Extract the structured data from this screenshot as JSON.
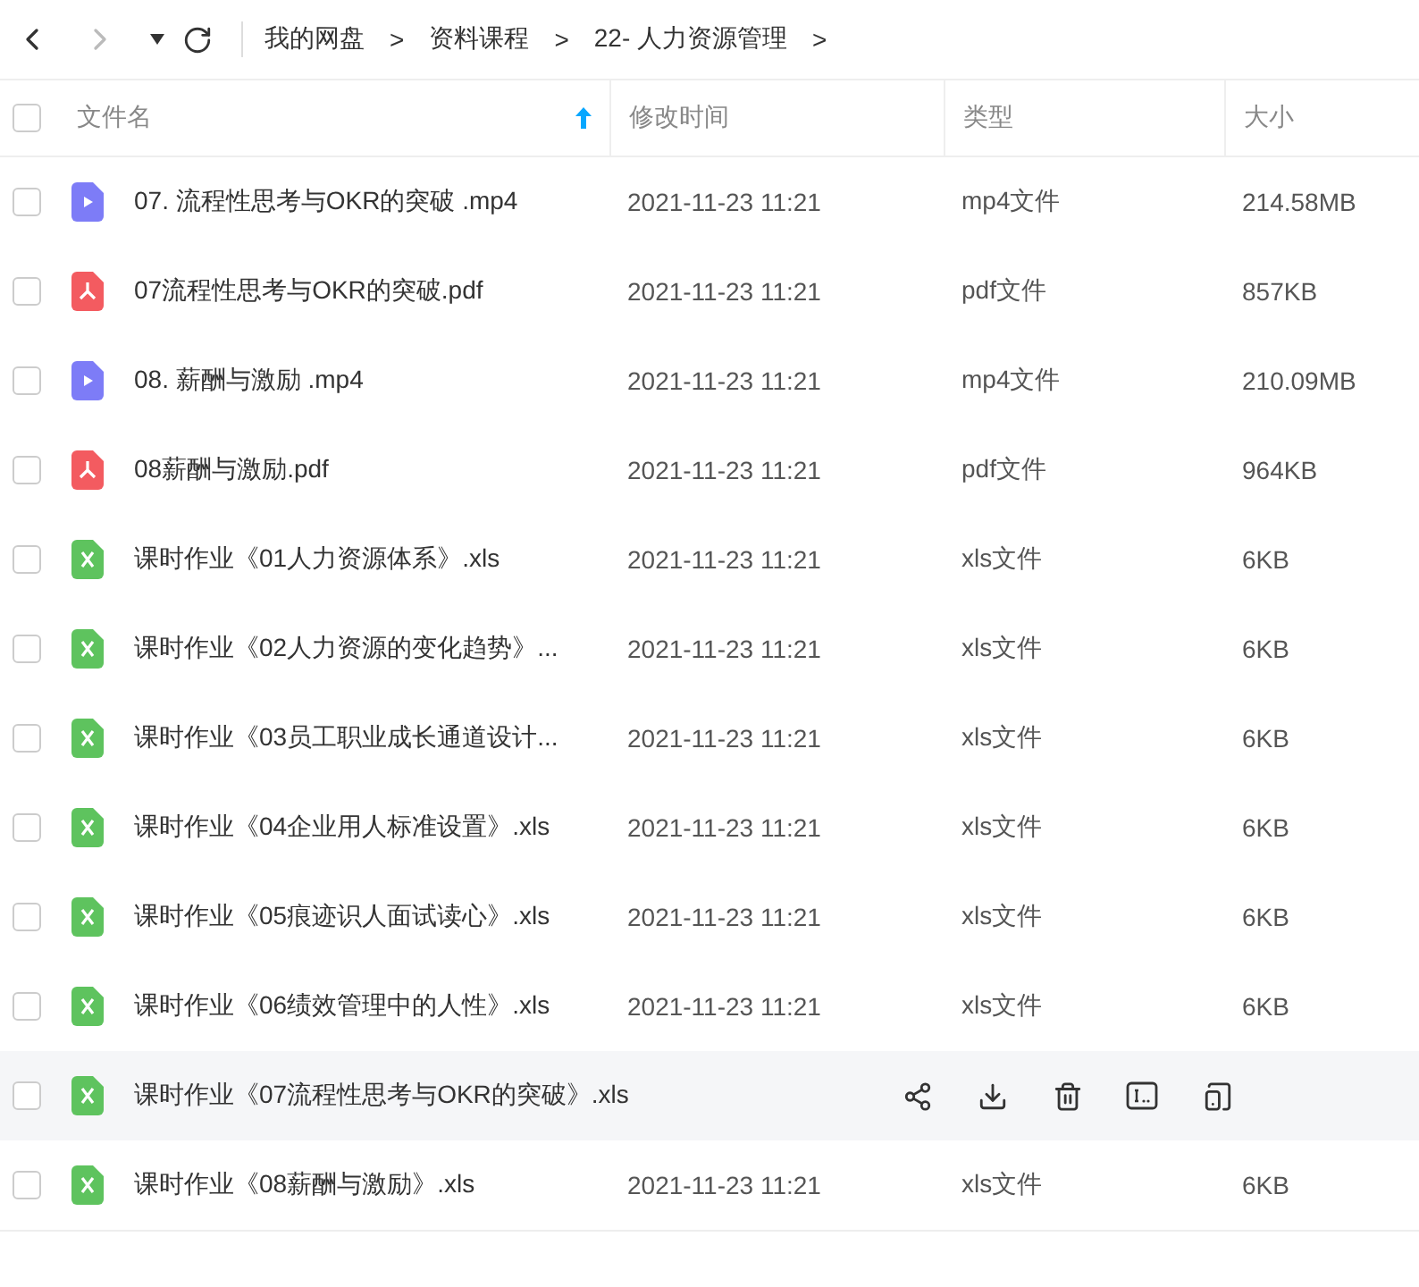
{
  "toolbar": {
    "back_enabled": true,
    "forward_enabled": false
  },
  "breadcrumbs": [
    "我的网盘",
    "资料课程",
    "22- 人力资源管理"
  ],
  "breadcrumb_separator": ">",
  "table": {
    "columns": [
      {
        "label": "文件名",
        "sorted": true
      },
      {
        "label": "修改时间",
        "sorted": false
      },
      {
        "label": "类型",
        "sorted": false
      },
      {
        "label": "大小",
        "sorted": false
      }
    ],
    "all_checked": false,
    "rows": [
      {
        "kind": "video",
        "name": "07. 流程性思考与OKR的突破  .mp4",
        "time": "2021-11-23 11:21",
        "type": "mp4文件",
        "size": "214.58MB",
        "checked": false,
        "hovered": false
      },
      {
        "kind": "pdf",
        "name": "07流程性思考与OKR的突破.pdf",
        "time": "2021-11-23 11:21",
        "type": "pdf文件",
        "size": "857KB",
        "checked": false,
        "hovered": false
      },
      {
        "kind": "video",
        "name": "08. 薪酬与激励  .mp4",
        "time": "2021-11-23 11:21",
        "type": "mp4文件",
        "size": "210.09MB",
        "checked": false,
        "hovered": false
      },
      {
        "kind": "pdf",
        "name": "08薪酬与激励.pdf",
        "time": "2021-11-23 11:21",
        "type": "pdf文件",
        "size": "964KB",
        "checked": false,
        "hovered": false
      },
      {
        "kind": "sheet",
        "name": "课时作业《01人力资源体系》.xls",
        "time": "2021-11-23 11:21",
        "type": "xls文件",
        "size": "6KB",
        "checked": false,
        "hovered": false
      },
      {
        "kind": "sheet",
        "name": "课时作业《02人力资源的变化趋势》...",
        "time": "2021-11-23 11:21",
        "type": "xls文件",
        "size": "6KB",
        "checked": false,
        "hovered": false
      },
      {
        "kind": "sheet",
        "name": "课时作业《03员工职业成长通道设计...",
        "time": "2021-11-23 11:21",
        "type": "xls文件",
        "size": "6KB",
        "checked": false,
        "hovered": false
      },
      {
        "kind": "sheet",
        "name": "课时作业《04企业用人标准设置》.xls",
        "time": "2021-11-23 11:21",
        "type": "xls文件",
        "size": "6KB",
        "checked": false,
        "hovered": false
      },
      {
        "kind": "sheet",
        "name": "课时作业《05痕迹识人面试读心》.xls",
        "time": "2021-11-23 11:21",
        "type": "xls文件",
        "size": "6KB",
        "checked": false,
        "hovered": false
      },
      {
        "kind": "sheet",
        "name": "课时作业《06绩效管理中的人性》.xls",
        "time": "2021-11-23 11:21",
        "type": "xls文件",
        "size": "6KB",
        "checked": false,
        "hovered": false
      },
      {
        "kind": "sheet",
        "name": "课时作业《07流程性思考与OKR的突破》.xls",
        "checked": false,
        "hovered": true
      },
      {
        "kind": "sheet",
        "name": "课时作业《08薪酬与激励》.xls",
        "time": "2021-11-23 11:21",
        "type": "xls文件",
        "size": "6KB",
        "checked": false,
        "hovered": false
      }
    ]
  }
}
